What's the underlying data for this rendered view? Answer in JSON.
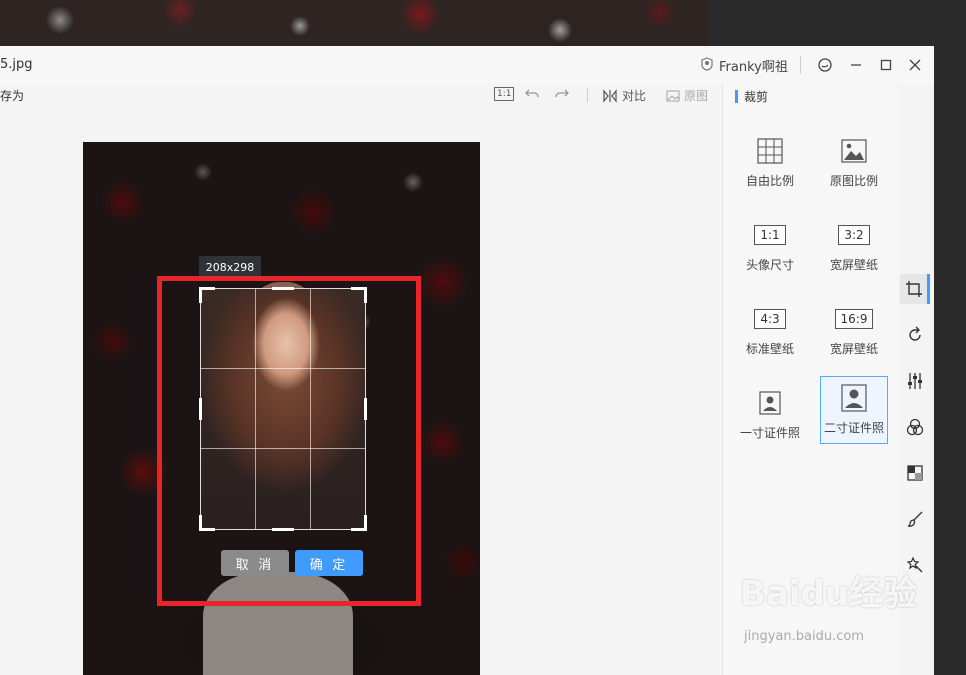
{
  "window": {
    "title": "5.jpg",
    "user_name": "Franky啊祖"
  },
  "toolbar": {
    "save_as": "存为",
    "actual_size": "1:1",
    "compare": "对比",
    "original": "原图"
  },
  "crop": {
    "size_label": "208x298",
    "cancel": "取 消",
    "confirm": "确 定"
  },
  "panel": {
    "title": "裁剪",
    "presets": [
      {
        "label": "自由比例",
        "icon": "grid-icon"
      },
      {
        "label": "原图比例",
        "icon": "image-icon"
      },
      {
        "label": "头像尺寸",
        "ratio": "1:1"
      },
      {
        "label": "宽屏壁纸",
        "ratio": "3:2"
      },
      {
        "label": "标准壁纸",
        "ratio": "4:3"
      },
      {
        "label": "宽屏壁纸",
        "ratio": "16:9"
      },
      {
        "label": "一寸证件照",
        "icon": "id-photo-icon"
      },
      {
        "label": "二寸证件照",
        "icon": "id-photo-icon",
        "selected": true
      }
    ]
  },
  "watermark": {
    "brand": "Baidu经验",
    "url": "jingyan.baidu.com"
  },
  "colors": {
    "accent": "#3f9bff",
    "highlight_border": "#e8252a"
  }
}
